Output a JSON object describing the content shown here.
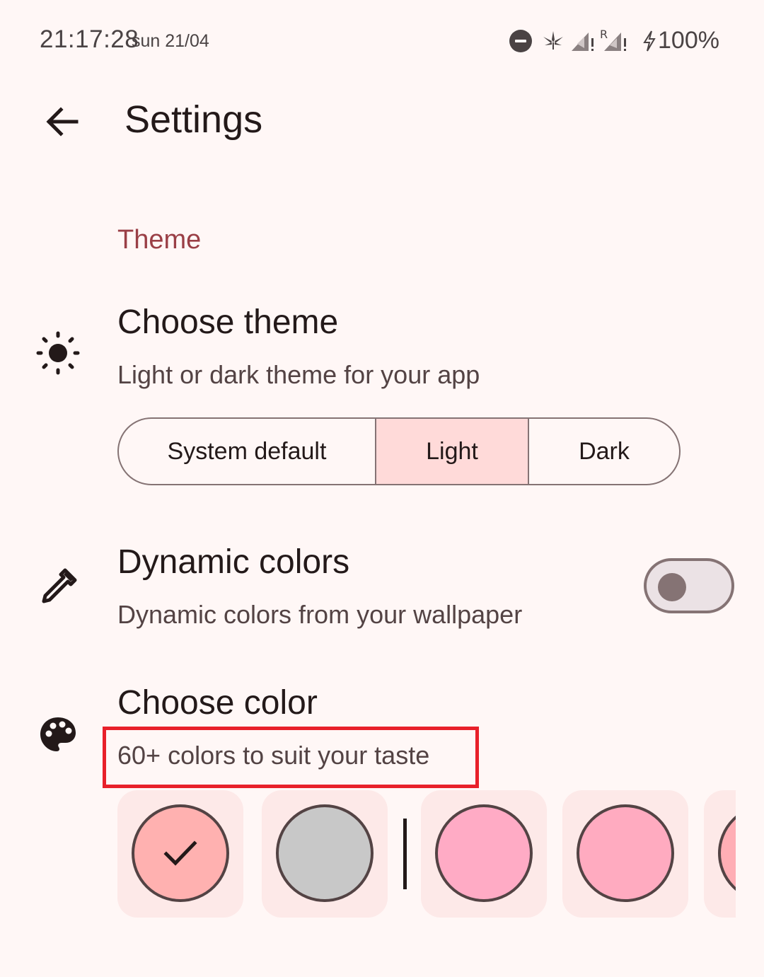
{
  "status_bar": {
    "time": "21:17:28",
    "date": "sun 21/04",
    "battery": "100%",
    "icons": [
      "dnd-icon",
      "cannabis-icon",
      "signal-1-icon",
      "signal-2-roaming-icon",
      "charging-icon"
    ]
  },
  "app_bar": {
    "title": "Settings",
    "back_icon": "arrow-back-icon"
  },
  "theme_section": {
    "header": "Theme",
    "choose_theme": {
      "icon": "sun-icon",
      "title": "Choose theme",
      "description": "Light or dark theme for your app",
      "options": [
        "System default",
        "Light",
        "Dark"
      ],
      "selected": "Light"
    },
    "dynamic_colors": {
      "icon": "eyedropper-icon",
      "title": "Dynamic colors",
      "description": "Dynamic colors from your wallpaper",
      "enabled": false
    },
    "choose_color": {
      "icon": "palette-icon",
      "title": "Choose color",
      "description": "60+ colors to suit your taste",
      "swatches": [
        {
          "color": "#ffb1b0",
          "selected": true
        },
        {
          "color": "#c8c8c8",
          "selected": false
        },
        {
          "color": "#ffabc5",
          "selected": false
        },
        {
          "color": "#ffabc0",
          "selected": false
        },
        {
          "color": "#ffaeb5",
          "selected": false
        }
      ]
    }
  },
  "colors": {
    "background": "#fff7f6",
    "accent": "#9a3f46",
    "selected_segment": "#ffdad9",
    "highlight": "#e8202a"
  }
}
